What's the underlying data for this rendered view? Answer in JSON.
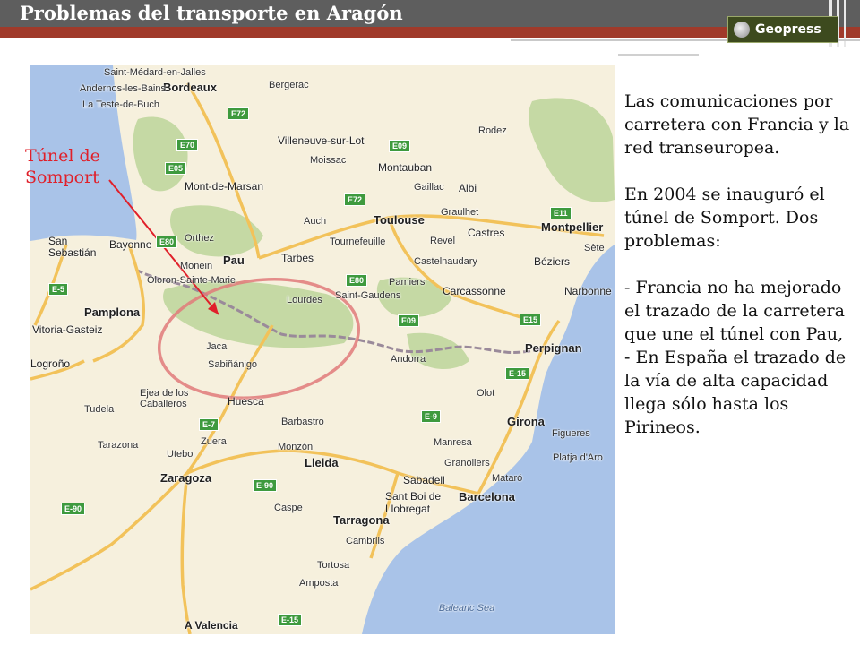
{
  "header": {
    "title": "Problemas del transporte en Aragón",
    "logo_text": "Geopress"
  },
  "map": {
    "callout": [
      "Túnel de",
      "Somport"
    ],
    "places": {
      "saint_medard": "Saint-Médard-en-Jalles",
      "bordeaux": "Bordeaux",
      "bergerac": "Bergerac",
      "andernos": "Andernos-les-Bains",
      "teste": "La Teste-de-Buch",
      "villeneuve": "Villeneuve-sur-Lot",
      "rodez": "Rodez",
      "moissac": "Moissac",
      "montauban": "Montauban",
      "mont_marsan": "Mont-de-Marsan",
      "gaillac": "Gaillac",
      "albi": "Albi",
      "auch": "Auch",
      "toulouse": "Toulouse",
      "graulhet": "Graulhet",
      "montpellier": "Montpellier",
      "san_sebastian": "San Sebastián",
      "bayonne": "Bayonne",
      "orthez": "Orthez",
      "tournefeuille": "Tournefeuille",
      "castres": "Castres",
      "revel": "Revel",
      "sete": "Sète",
      "beziers": "Béziers",
      "monein": "Monein",
      "pau": "Pau",
      "tarbes": "Tarbes",
      "castelnaudary": "Castelnaudary",
      "oloron": "Oloron-Sainte-Marie",
      "lourdes": "Lourdes",
      "saint_gaudens": "Saint-Gaudens",
      "pamiers": "Pamiers",
      "carcassonne": "Carcassonne",
      "narbonne": "Narbonne",
      "pamplona": "Pamplona",
      "vitoria": "Vitoria-Gasteiz",
      "logrono": "Logroño",
      "jaca": "Jaca",
      "sabinanigo": "Sabiñánigo",
      "andorra": "Andorra",
      "perpignan": "Perpignan",
      "olot": "Olot",
      "ejea": "Ejea de los Caballeros",
      "huesca": "Huesca",
      "girona": "Girona",
      "tudela": "Tudela",
      "tarazona": "Tarazona",
      "barbastro": "Barbastro",
      "figueres": "Figueres",
      "utebo": "Utebo",
      "zuera": "Zuera",
      "monzon": "Monzón",
      "manresa": "Manresa",
      "zaragoza": "Zaragoza",
      "lleida": "Lleida",
      "granollers": "Granollers",
      "mataro": "Mataró",
      "sabadell": "Sabadell",
      "barcelona": "Barcelona",
      "sant_boi": "Sant Boi de Llobregat",
      "caspe": "Caspe",
      "tarragona": "Tarragona",
      "cambrils": "Cambrils",
      "tortosa": "Tortosa",
      "amposta": "Amposta",
      "platja": "Platja d'Aro",
      "balearic": "Balearic Sea",
      "valencia": "A Valencia"
    },
    "roads": [
      "E72",
      "E70",
      "E05",
      "E09",
      "E72",
      "E11",
      "E80",
      "E80",
      "E-5",
      "E-7",
      "E09",
      "E15",
      "E-15",
      "E-9",
      "E-90",
      "E-90",
      "E-15"
    ]
  },
  "text": {
    "p1": "Las comunicaciones por carretera con Francia y la red transeuropea.",
    "p2": "En 2004 se inauguró el túnel de Somport. Dos problemas:",
    "p3": "- Francia no ha mejorado el trazado de la carretera que une el túnel con Pau,",
    "p4": "- En España el trazado de la vía de alta capacidad llega sólo hasta los Pirineos."
  },
  "colors": {
    "title_bar": "#5e5e5e",
    "title_red": "#a03a2a",
    "callout": "#e0202a",
    "sea": "#a9c3e8",
    "forest": "#c5d9a4"
  }
}
